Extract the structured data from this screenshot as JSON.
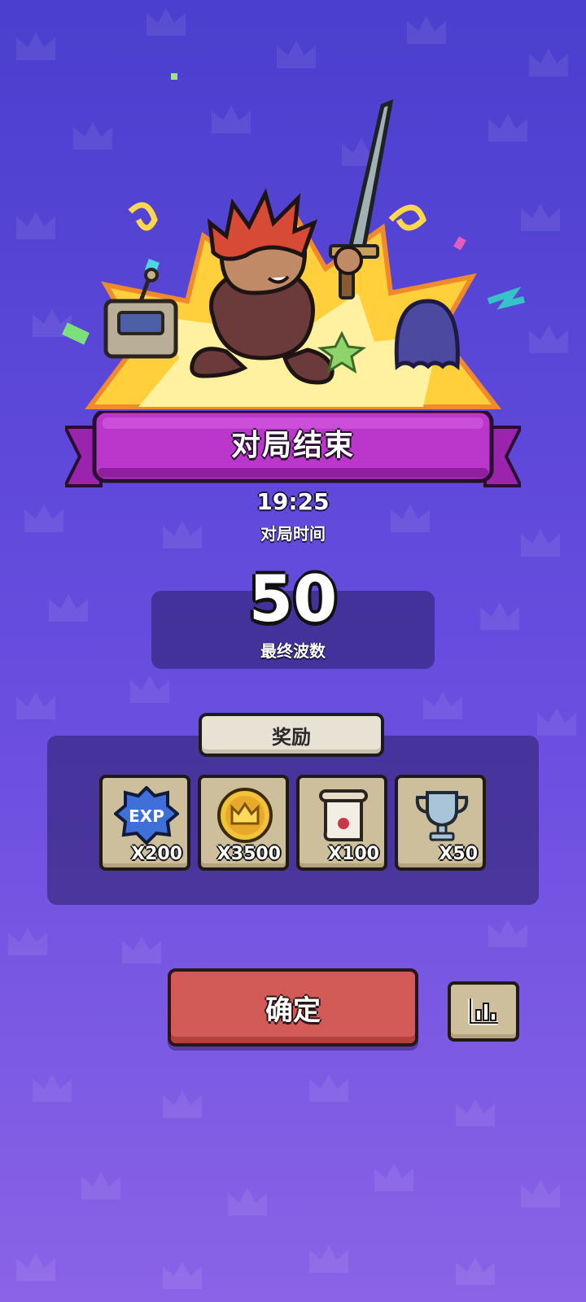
{
  "header": {
    "title": "对局结束"
  },
  "stats": {
    "match_time": "19:25",
    "match_time_label": "对局时间",
    "final_wave": "50",
    "final_wave_label": "最终波数"
  },
  "rewards": {
    "tab_label": "奖励",
    "items": [
      {
        "icon": "exp-badge-icon",
        "icon_text": "EXP",
        "quantity": "X200"
      },
      {
        "icon": "gold-crown-coin-icon",
        "quantity": "X3500"
      },
      {
        "icon": "scroll-icon",
        "quantity": "X100"
      },
      {
        "icon": "silver-trophy-icon",
        "quantity": "X50"
      }
    ]
  },
  "actions": {
    "confirm_label": "确定",
    "stats_icon": "bar-chart-icon"
  },
  "colors": {
    "background_top": "#4a3fce",
    "background_bottom": "#8a63e6",
    "ribbon": "#b236c4",
    "confirm_button": "#d35b57",
    "reward_tile": "#cdbe9c"
  }
}
